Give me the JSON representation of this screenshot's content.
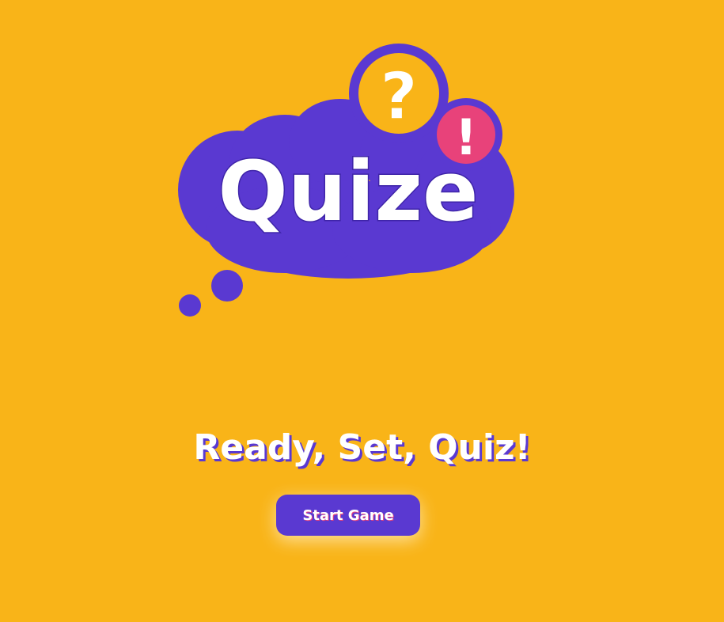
{
  "logo": {
    "wordmark": "Quize",
    "question_mark": "?",
    "exclamation_mark": "!"
  },
  "headline": "Ready, Set, Quiz!",
  "start_button": {
    "label": "Start Game"
  },
  "colors": {
    "background": "#F9B418",
    "cloud_purple": "#5A39D1",
    "accent_pink": "#E8427A",
    "white": "#FFFFFF"
  },
  "icons": {
    "cloud": "thought-cloud-icon",
    "question": "question-mark-icon",
    "exclamation": "exclamation-mark-icon"
  }
}
